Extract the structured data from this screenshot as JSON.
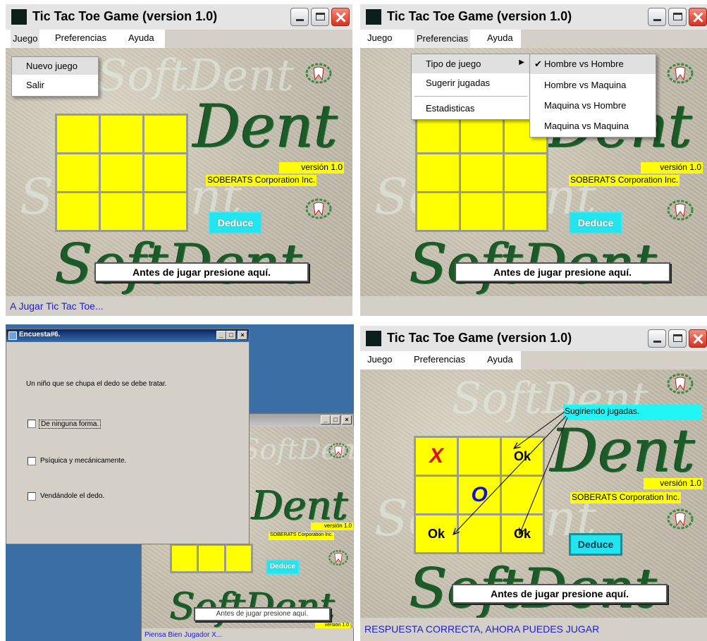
{
  "window_title": "Tic Tac Toe Game (version 1.0)",
  "menus": [
    "Juego",
    "Preferencias",
    "Ayuda"
  ],
  "game_menu": {
    "items": [
      "Nuevo juego",
      "Salir"
    ]
  },
  "prefs_menu": {
    "items": [
      "Tipo de juego",
      "Sugerir jugadas",
      "Estadisticas"
    ]
  },
  "type_submenu": {
    "items": [
      "Hombre vs Hombre",
      "Hombre vs Maquina",
      "Maquina vs Hombre",
      "Maquina vs Maquina"
    ],
    "checked_index": 0,
    "check_mark": "✔"
  },
  "branding": {
    "logo": "Dent",
    "watermark": "SoftDent",
    "version": "versión 1.0",
    "company": "SOBERATS Corporation Inc."
  },
  "buttons": {
    "deduce": "Deduce",
    "antes": "Antes de jugar presione aquí."
  },
  "status": {
    "panel1": "A Jugar Tic Tac Toe...",
    "panel3": "Piensa Bien Jugador X...",
    "panel4": "RESPUESTA CORRECTA, AHORA PUEDES JUGAR"
  },
  "survey": {
    "title": "Encuesta#6.",
    "question": "Un niño que se chupa el dedo se debe tratar.",
    "options": [
      "De ninguna forma.",
      "Psíquica y mecánicamente.",
      "Vendándole el dedo."
    ]
  },
  "hint": {
    "label": "Sugiriendo jugadas.",
    "board": [
      "X",
      "",
      "Ok",
      "",
      "O",
      "",
      "Ok",
      "",
      "Ok"
    ]
  },
  "colors": {
    "cell": "#ffff00",
    "deduce": "#21e6f0",
    "status_text": "#2020c8",
    "x_mark": "#e01010",
    "o_mark": "#1010d0"
  }
}
